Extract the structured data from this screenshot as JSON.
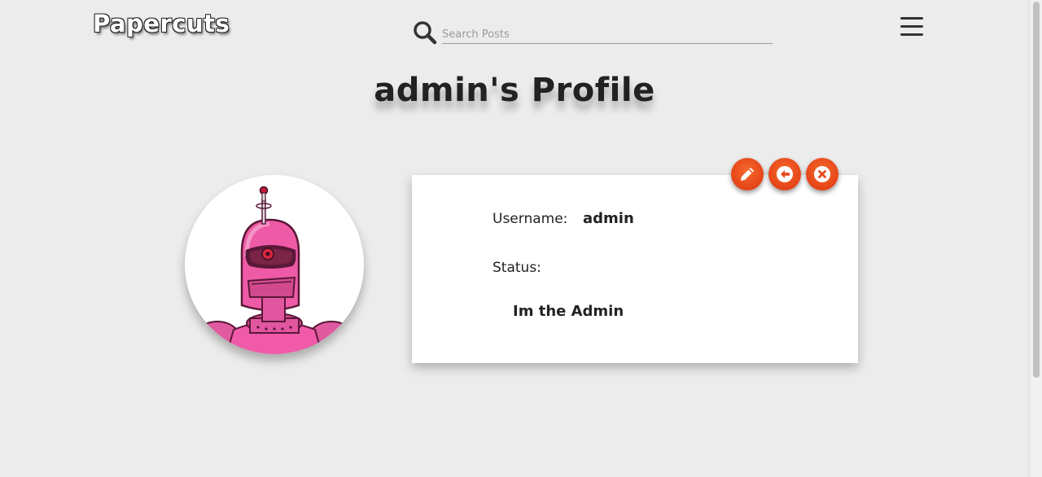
{
  "header": {
    "logo": "Papercuts",
    "search_placeholder": "Search Posts",
    "search_value": "",
    "search_icon": "search-icon",
    "menu_icon": "hamburger-menu-icon"
  },
  "main": {
    "title": "admin's Profile",
    "avatar_description": "avatar",
    "profile": {
      "username_label": "Username:",
      "username_value": "admin",
      "status_label": "Status:",
      "status_value": "Im the Admin"
    },
    "actions": [
      {
        "name": "edit",
        "icon": "pencil-icon"
      },
      {
        "name": "back",
        "icon": "arrow-left-icon"
      },
      {
        "name": "delete",
        "icon": "close-icon"
      }
    ]
  },
  "colors": {
    "background": "#ececec",
    "card": "#ffffff",
    "accent": "#e8491a",
    "text": "#222222"
  }
}
